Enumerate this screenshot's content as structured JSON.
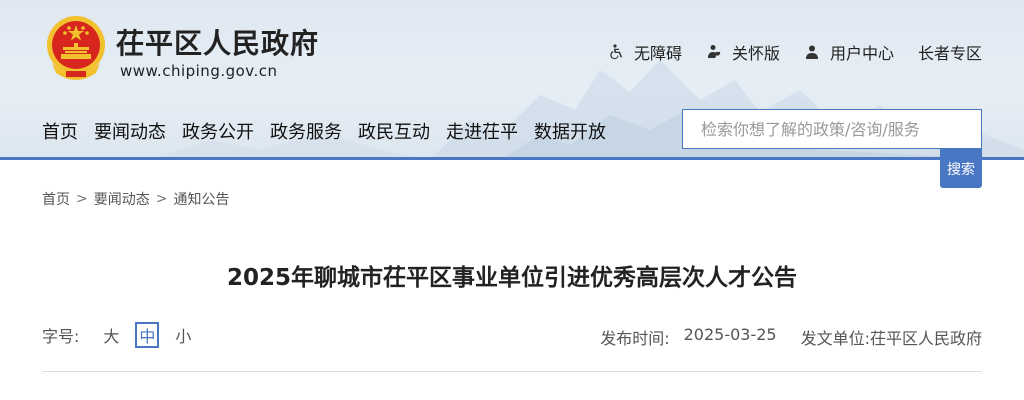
{
  "site": {
    "title": "茌平区人民政府",
    "url": "www.chiping.gov.cn"
  },
  "top_links": [
    {
      "label": "无障碍",
      "icon": "wheelchair-icon"
    },
    {
      "label": "关怀版",
      "icon": "care-icon"
    },
    {
      "label": "用户中心",
      "icon": "user-icon"
    },
    {
      "label": "长者专区",
      "icon": ""
    }
  ],
  "nav": [
    "首页",
    "要闻动态",
    "政务公开",
    "政务服务",
    "政民互动",
    "走进茌平",
    "数据开放"
  ],
  "search": {
    "placeholder": "检索你想了解的政策/咨询/服务",
    "value": "",
    "button_label": "搜索"
  },
  "breadcrumb": [
    "首页",
    "要闻动态",
    "通知公告"
  ],
  "breadcrumb_sep": ">",
  "article": {
    "title": "2025年聊城市茌平区事业单位引进优秀高层次人才公告",
    "font_size_label": "字号:",
    "font_sizes": [
      "大",
      "中",
      "小"
    ],
    "font_size_selected": "中",
    "publish_label": "发布时间:",
    "publish_date": "2025-03-25",
    "issuer": "发文单位:茌平区人民政府"
  },
  "colors": {
    "accent": "#4a77c4",
    "header_bg": "#e3ebf3",
    "emblem_red": "#d7261e",
    "emblem_gold": "#f2c12e"
  }
}
